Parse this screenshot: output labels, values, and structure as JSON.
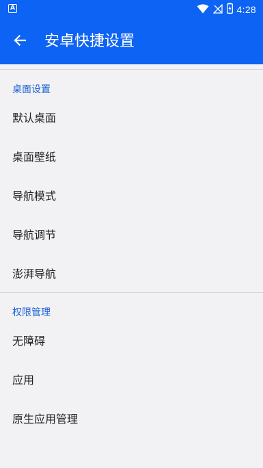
{
  "status_bar": {
    "notification_icon_letter": "A",
    "time": "4:28"
  },
  "app_bar": {
    "title": "安卓快捷设置"
  },
  "sections": [
    {
      "header": "桌面设置",
      "items": [
        "默认桌面",
        "桌面壁纸",
        "导航模式",
        "导航调节",
        "澎湃导航"
      ]
    },
    {
      "header": "权限管理",
      "items": [
        "无障碍",
        "应用",
        "原生应用管理"
      ]
    }
  ]
}
